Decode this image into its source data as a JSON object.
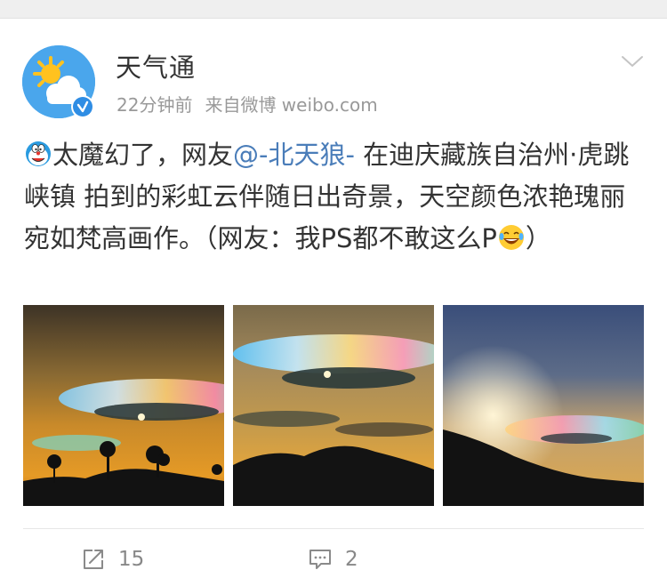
{
  "post": {
    "author": "天气通",
    "time": "22分钟前",
    "source": "来自微博 weibo.com",
    "text_part1": "太魔幻了，网友",
    "mention": "@-北天狼-",
    "text_part2": " 在迪庆藏族自治州·虎跳峡镇 拍到的彩虹云伴随日出奇景，天空颜色浓艳瑰丽宛如梵高画作。（网友：我PS都不敢这么P",
    "text_part3": "）",
    "emoji_start": "doraemon-emoji",
    "emoji_end": "laugh-cry-emoji"
  },
  "photos": [
    {
      "name": "iridescent-cloud-photo-1"
    },
    {
      "name": "iridescent-cloud-photo-2"
    },
    {
      "name": "iridescent-cloud-photo-3"
    }
  ],
  "actions": {
    "repost_count": "15",
    "comment_count": "2",
    "repost_icon": "share-icon",
    "comment_icon": "comment-icon"
  },
  "colors": {
    "mention": "#4a7db9",
    "meta_text": "#999999",
    "avatar_bg": "#4aa6ec",
    "verified_badge": "#2f8de4"
  }
}
